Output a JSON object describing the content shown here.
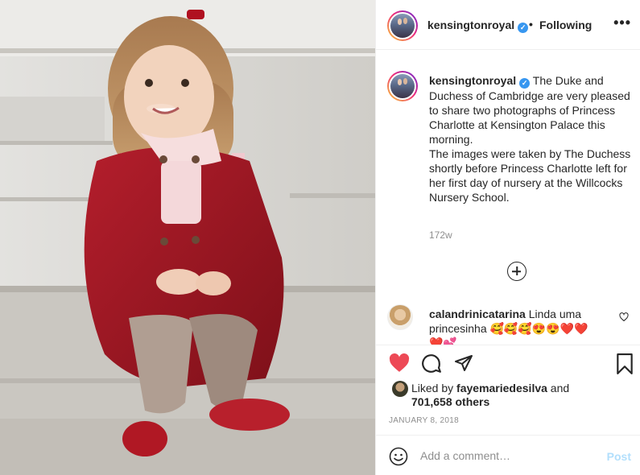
{
  "post": {
    "username": "kensingtonroyal",
    "verified_icon": "verified-badge-icon",
    "separator": "•",
    "follow_status": "Following",
    "more": "•••"
  },
  "caption": {
    "username": "kensingtonroyal",
    "text": " The Duke and Duchess of Cambridge are very pleased to share two photographs of Princess Charlotte at Kensington Palace this morning.",
    "text2": "The images were taken by The Duchess shortly before Princess Charlotte left for her first day of nursery at the Willcocks Nursery School.",
    "age": "172w"
  },
  "comment": {
    "username": "calandrinicatarina",
    "text": " Linda uma princesinha 🥰🥰🥰😍😍❤️❤️",
    "text_overflow": "❤️💕"
  },
  "likes": {
    "liked_by_prefix": "Liked by ",
    "liked_by_user": "fayemariedesilva",
    "liked_by_suffix": " and",
    "others": "701,658 others"
  },
  "date": "JANUARY 8, 2018",
  "add_comment": {
    "placeholder": "Add a comment…",
    "post_label": "Post"
  },
  "colors": {
    "like_red": "#ed4956",
    "verified_blue": "#3897f0",
    "post_disabled": "#b2dffc",
    "muted_text": "#8e8e8e"
  },
  "icons": [
    "heart-icon",
    "comment-icon",
    "share-icon",
    "bookmark-icon",
    "emoji-icon",
    "load-more-icon",
    "comment-like-icon"
  ]
}
